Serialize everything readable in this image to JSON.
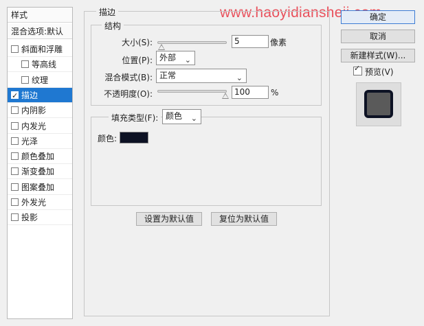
{
  "watermark": "www.haoyidiansheji.com",
  "left_panel": {
    "header": "样式",
    "blend_options": "混合选项:默认",
    "items": [
      {
        "label": "斜面和浮雕",
        "checked": false,
        "sub": false,
        "selected": false
      },
      {
        "label": "等高线",
        "checked": false,
        "sub": true,
        "selected": false
      },
      {
        "label": "纹理",
        "checked": false,
        "sub": true,
        "selected": false
      },
      {
        "label": "描边",
        "checked": true,
        "sub": false,
        "selected": true
      },
      {
        "label": "内阴影",
        "checked": false,
        "sub": false,
        "selected": false
      },
      {
        "label": "内发光",
        "checked": false,
        "sub": false,
        "selected": false
      },
      {
        "label": "光泽",
        "checked": false,
        "sub": false,
        "selected": false
      },
      {
        "label": "颜色叠加",
        "checked": false,
        "sub": false,
        "selected": false
      },
      {
        "label": "渐变叠加",
        "checked": false,
        "sub": false,
        "selected": false
      },
      {
        "label": "图案叠加",
        "checked": false,
        "sub": false,
        "selected": false
      },
      {
        "label": "外发光",
        "checked": false,
        "sub": false,
        "selected": false
      },
      {
        "label": "投影",
        "checked": false,
        "sub": false,
        "selected": false
      }
    ]
  },
  "stroke": {
    "title": "描边",
    "structure": {
      "title": "结构",
      "size_label": "大小(S):",
      "size_value": "5",
      "size_unit": "像素",
      "size_slider_fraction": 0.02,
      "position_label": "位置(P):",
      "position_value": "外部",
      "blend_label": "混合模式(B):",
      "blend_value": "正常",
      "opacity_label": "不透明度(O):",
      "opacity_value": "100",
      "opacity_unit": "%",
      "opacity_slider_fraction": 1.0
    },
    "fill": {
      "fill_type_label": "填充类型(F):",
      "fill_type_value": "颜色",
      "color_label": "颜色:",
      "color": "#0d1224"
    },
    "set_default": "设置为默认值",
    "reset_default": "复位为默认值"
  },
  "right_panel": {
    "ok": "确定",
    "cancel": "取消",
    "new_style": "新建样式(W)...",
    "preview_label": "预览(V)",
    "preview_checked": true
  }
}
